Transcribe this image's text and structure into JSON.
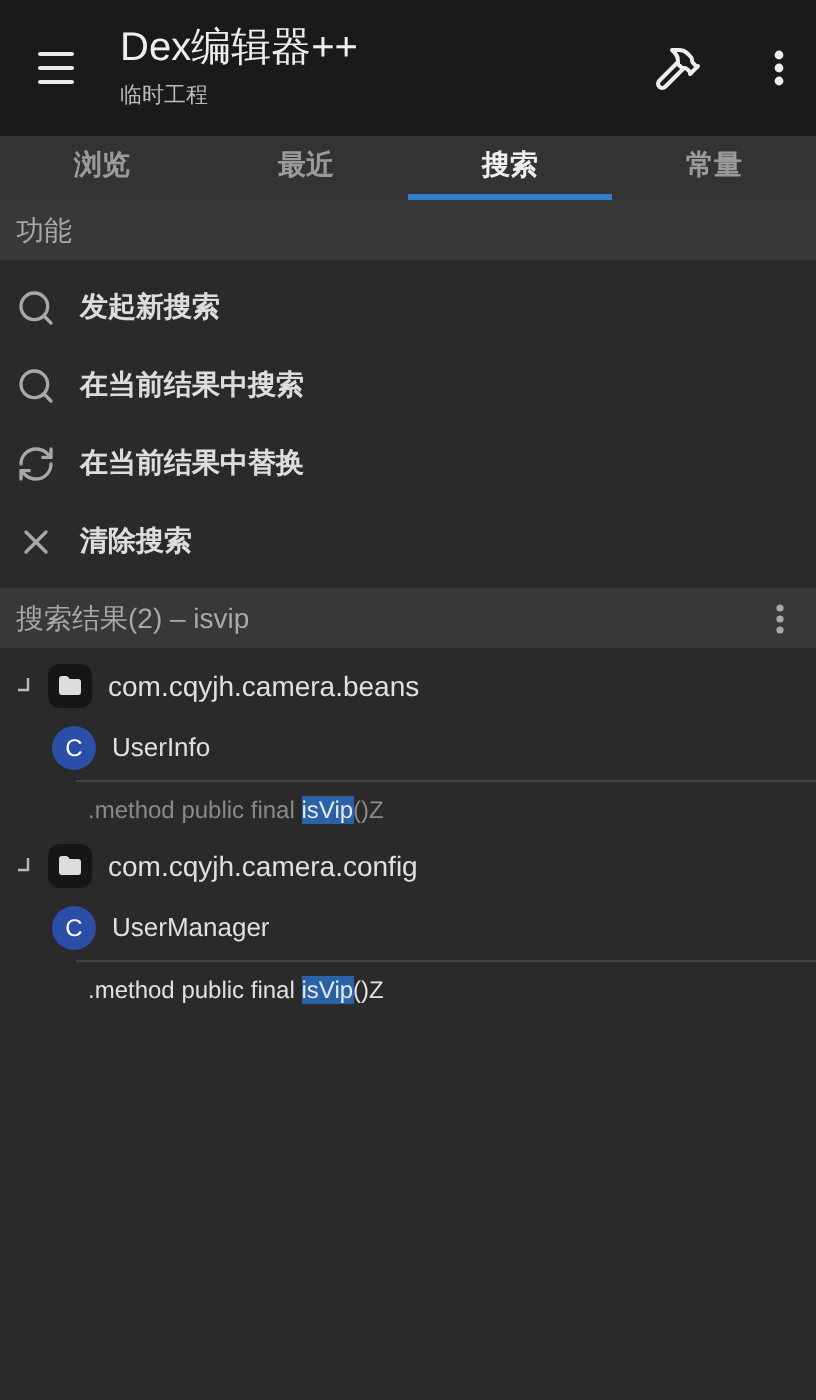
{
  "app_bar": {
    "title": "Dex编辑器++",
    "subtitle": "临时工程"
  },
  "tabs": [
    {
      "label": "浏览",
      "selected": false
    },
    {
      "label": "最近",
      "selected": false
    },
    {
      "label": "搜索",
      "selected": true
    },
    {
      "label": "常量",
      "selected": false
    }
  ],
  "functions": {
    "header": "功能",
    "items": [
      {
        "kind": "search",
        "label": "发起新搜索"
      },
      {
        "kind": "search",
        "label": "在当前结果中搜索"
      },
      {
        "kind": "replace",
        "label": "在当前结果中替换"
      },
      {
        "kind": "clear",
        "label": "清除搜索"
      }
    ]
  },
  "results": {
    "header": "搜索结果(2) – isvip",
    "tree": [
      {
        "label": "com.cqyjh.camera.beans",
        "expanded": true,
        "children": [
          {
            "label": "UserInfo",
            "badge": "C",
            "children": [
              {
                "before": ".method public final ",
                "match": "isVip",
                "after": "()Z",
                "dimmed": true
              }
            ]
          }
        ]
      },
      {
        "label": "com.cqyjh.camera.config",
        "expanded": true,
        "children": [
          {
            "label": "UserManager",
            "badge": "C",
            "children": [
              {
                "before": ".method public final ",
                "match": "isVip",
                "after": "()Z",
                "dimmed": false
              }
            ]
          }
        ]
      }
    ]
  }
}
